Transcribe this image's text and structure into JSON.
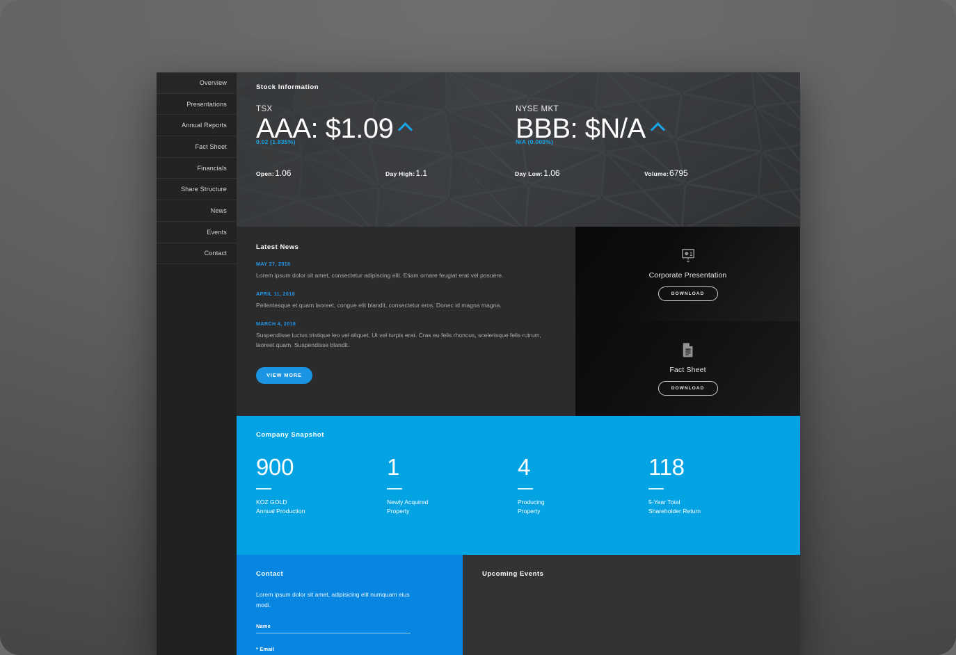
{
  "colors": {
    "accent_blue": "#03A3E4",
    "link_blue": "#2196E8",
    "button_blue": "#1B95E3",
    "contact_blue": "#0686E0",
    "sidebar_bg": "#212121",
    "panel_bg": "#2b2b2b",
    "events_bg": "#333333"
  },
  "sidebar": {
    "items": [
      {
        "label": "Overview",
        "active": true
      },
      {
        "label": "Presentations",
        "active": false
      },
      {
        "label": "Annual Reports",
        "active": false
      },
      {
        "label": "Fact Sheet",
        "active": false
      },
      {
        "label": "Financials",
        "active": false
      },
      {
        "label": "Share Structure",
        "active": false
      },
      {
        "label": "News",
        "active": false
      },
      {
        "label": "Events",
        "active": false
      },
      {
        "label": "Contact",
        "active": false
      }
    ]
  },
  "hero": {
    "title": "Stock Information",
    "quotes": [
      {
        "exchange": "TSX",
        "price": "AAA: $1.09",
        "change": "0.02 (1.835%)",
        "direction": "up"
      },
      {
        "exchange": "NYSE MKT",
        "price": "BBB: $N/A",
        "change": "N/A (0.000%)",
        "direction": "up"
      }
    ],
    "metrics": [
      {
        "label": "Open:",
        "value": "1.06"
      },
      {
        "label": "Day High:",
        "value": "1.1"
      },
      {
        "label": "Day Low:",
        "value": "1.06"
      },
      {
        "label": "Volume:",
        "value": "6795"
      }
    ]
  },
  "news": {
    "title": "Latest News",
    "items": [
      {
        "date": "MAY 27, 2018",
        "text": "Lorem ipsum dolor sit amet, consectetur adipiscing elit. Etiam ornare feugiat erat vel posuere."
      },
      {
        "date": "APRIL 11, 2018",
        "text": "Pellentesque et quam laoreet, congue elit blandit, consectetur eros. Donec id magna magna."
      },
      {
        "date": "MARCH 4, 2018",
        "text": "Suspendisse luctus tristique leo vel aliquet. Ut vel turpis erat. Cras eu felis rhoncus, scelerisque felis rutrum, laoreet quam. Suspendisse blandit."
      }
    ],
    "view_more_label": "VIEW MORE"
  },
  "downloads": [
    {
      "icon": "presentation-icon",
      "label": "Corporate Presentation",
      "button_label": "DOWNLOAD"
    },
    {
      "icon": "document-icon",
      "label": "Fact Sheet",
      "button_label": "DOWNLOAD"
    }
  ],
  "snapshot": {
    "title": "Company Snapshot",
    "stats": [
      {
        "value": "900",
        "label_line1": "KOZ GOLD",
        "label_line2": "Annual Production"
      },
      {
        "value": "1",
        "label_line1": "Newly Acquired",
        "label_line2": "Property"
      },
      {
        "value": "4",
        "label_line1": "Producing",
        "label_line2": "Property"
      },
      {
        "value": "118",
        "label_line1": "5-Year Total",
        "label_line2": "Shareholder Return"
      }
    ]
  },
  "contact": {
    "title": "Contact",
    "blurb": "Lorem ipsum dolor sit amet, adipisicing elit numquam eius modi.",
    "fields": [
      {
        "label": "Name",
        "value": "",
        "placeholder": ""
      },
      {
        "label": "* Email",
        "value": "",
        "placeholder": ""
      }
    ]
  },
  "events": {
    "title": "Upcoming Events"
  }
}
